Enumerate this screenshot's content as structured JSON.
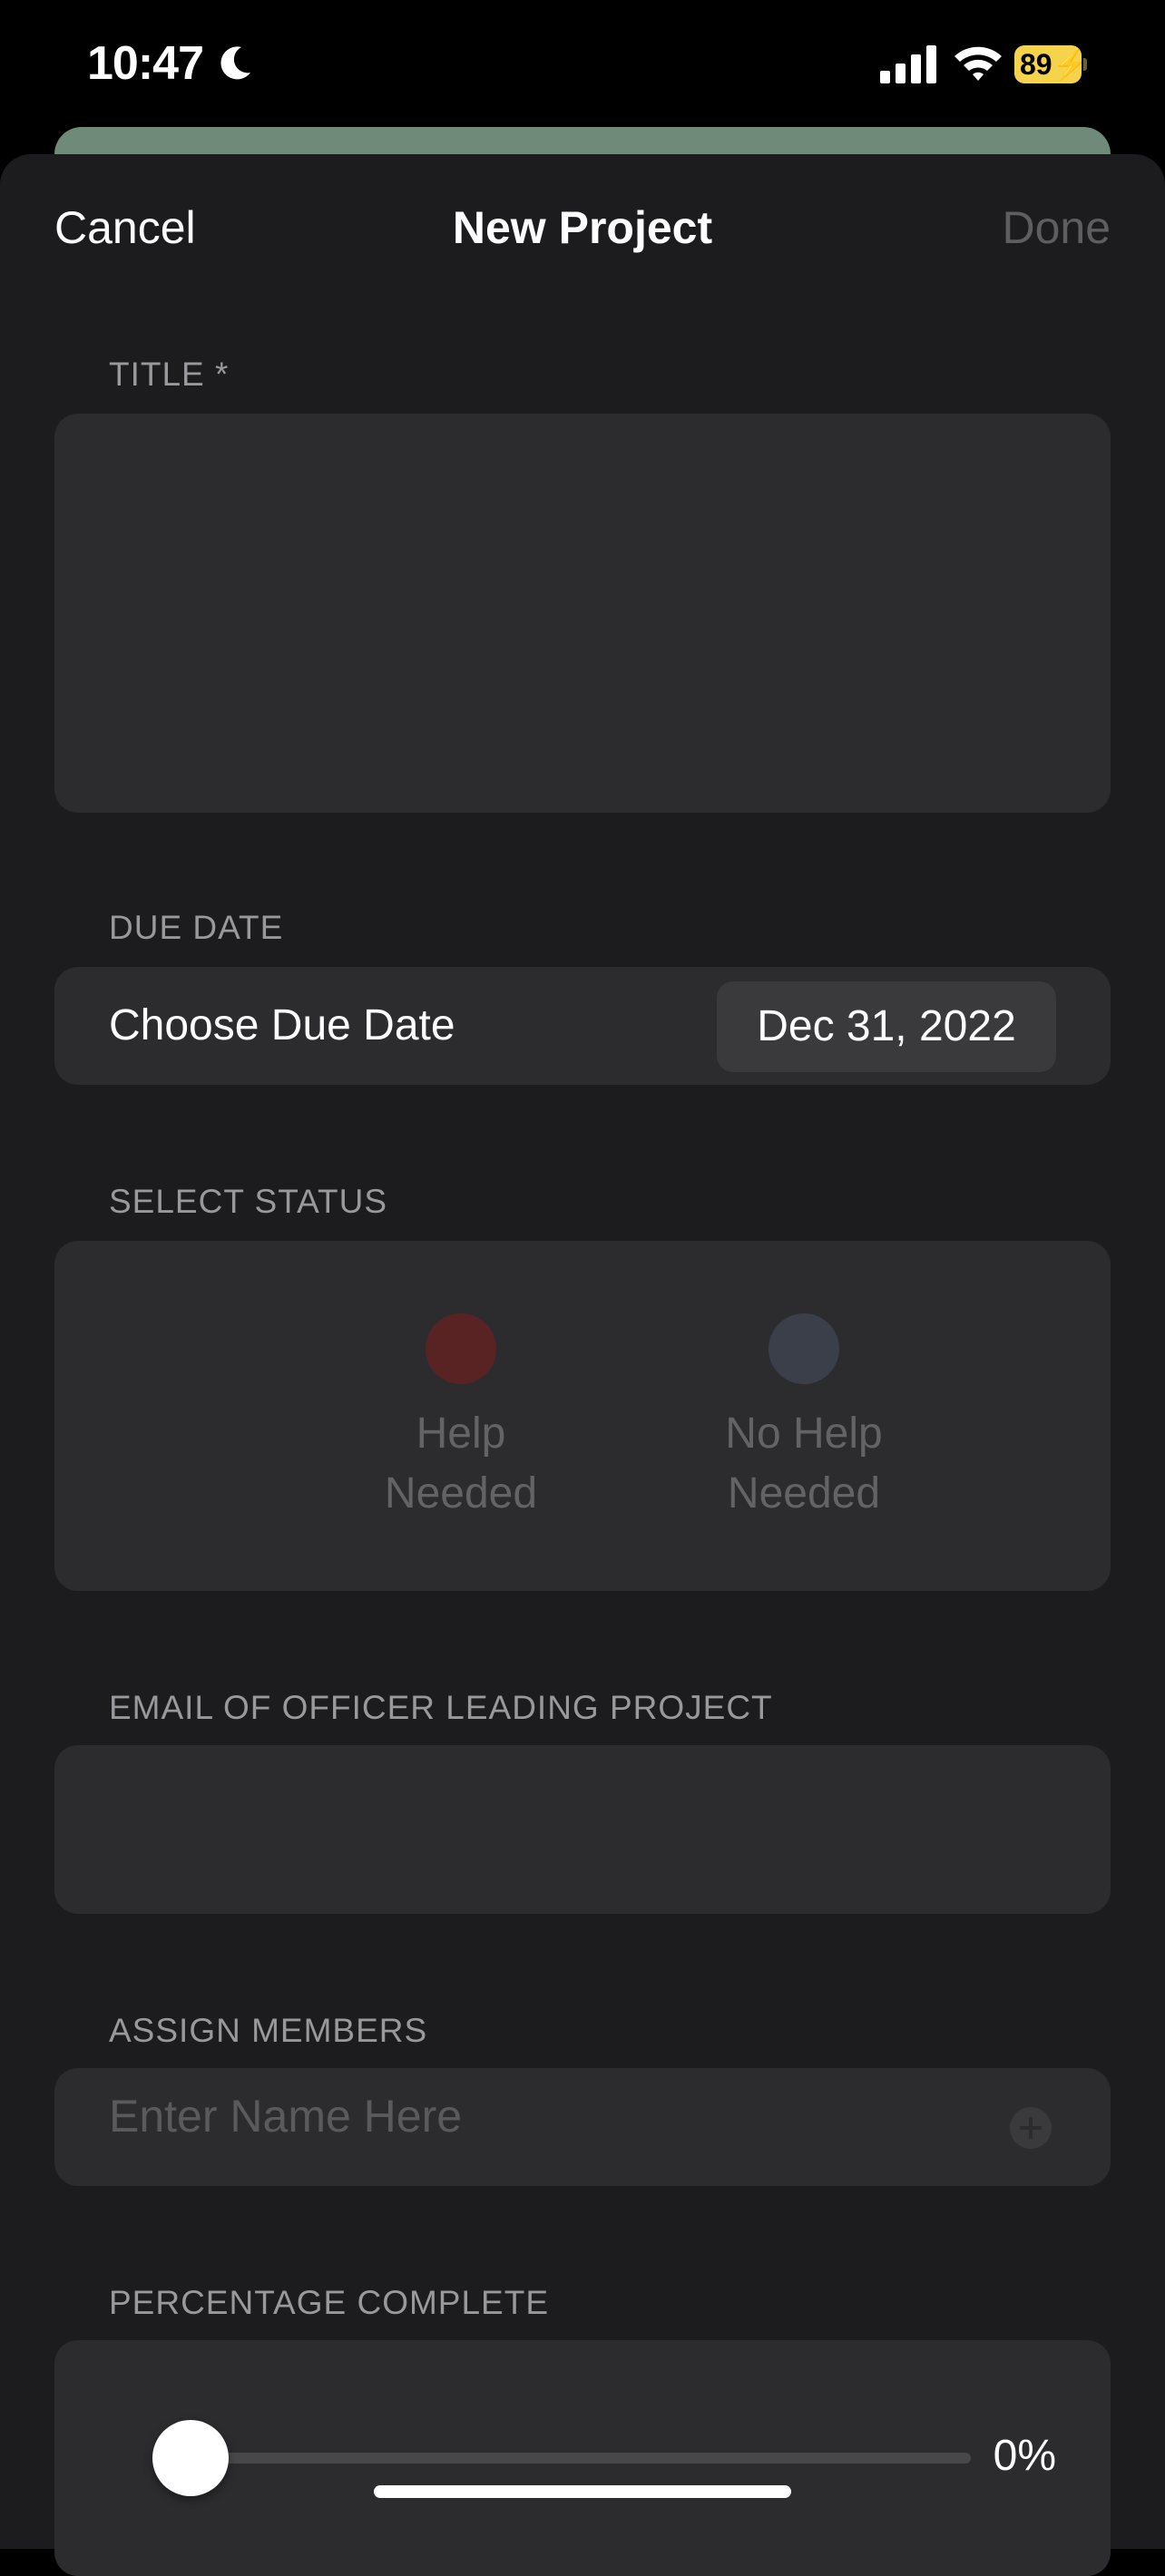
{
  "status_bar": {
    "time": "10:47",
    "battery_level": "89"
  },
  "nav": {
    "cancel_label": "Cancel",
    "title": "New Project",
    "done_label": "Done"
  },
  "form": {
    "title_label": "TITLE *",
    "title_value": "",
    "due_date_label": "DUE DATE",
    "due_date_row_label": "Choose Due Date",
    "due_date_value": "Dec 31, 2022",
    "status_label": "SELECT STATUS",
    "status_options": [
      {
        "line1": "Help",
        "line2": "Needed",
        "color": "#5a2323"
      },
      {
        "line1": "No Help",
        "line2": "Needed",
        "color": "#3a3f4a"
      }
    ],
    "email_label": "EMAIL OF OFFICER LEADING PROJECT",
    "email_value": "",
    "members_label": "ASSIGN MEMBERS",
    "members_placeholder": "Enter Name Here",
    "percentage_label": "PERCENTAGE COMPLETE",
    "percentage_value": 0,
    "percentage_text": "0%"
  },
  "colors": {
    "sheet_bg": "#1c1c1e",
    "group_bg": "#2c2c2e",
    "accent_bg_card": "#6f8a78",
    "battery": "#f5d34b"
  }
}
